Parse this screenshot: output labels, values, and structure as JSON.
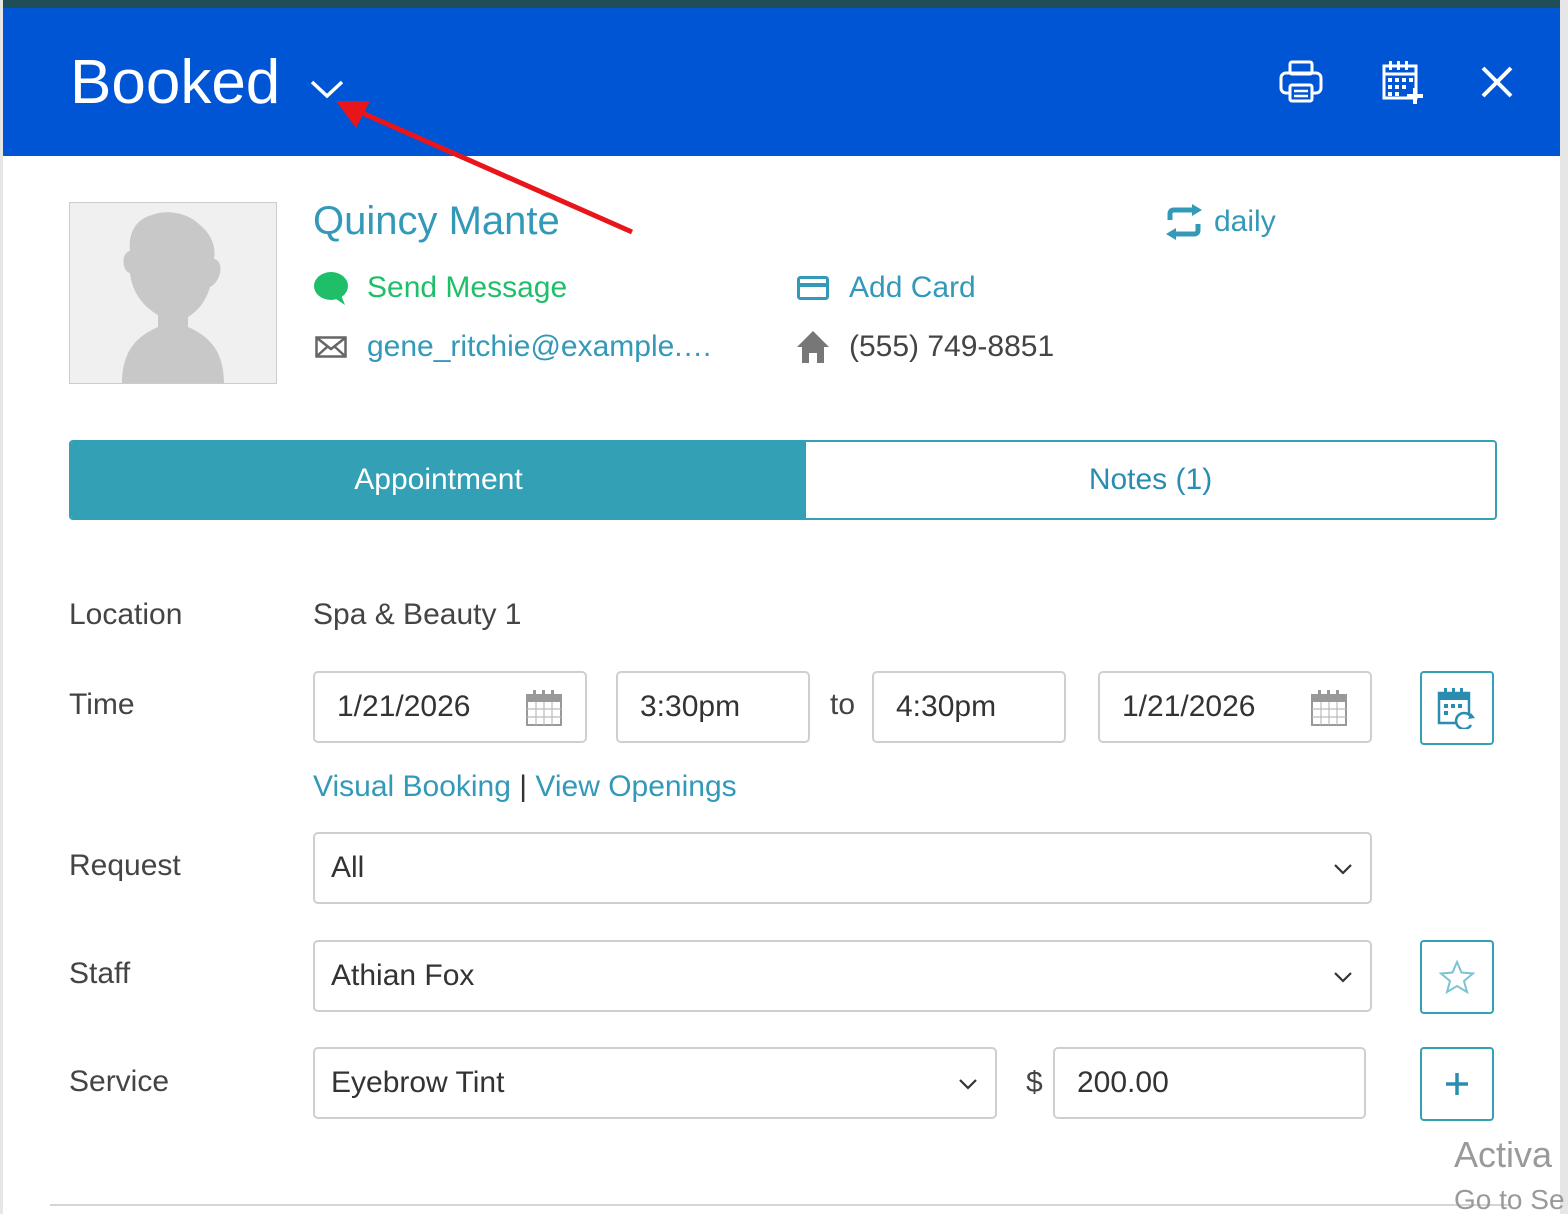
{
  "header": {
    "status": "Booked",
    "bg_color": "#0055d4",
    "icons": [
      "printer-icon",
      "calendar-add-icon",
      "close-icon"
    ]
  },
  "client": {
    "name": "Quincy Mante",
    "recurrence": "daily",
    "send_message": "Send Message",
    "add_card": "Add Card",
    "email": "gene_ritchie@example.…",
    "phone": "(555) 749-8851"
  },
  "tabs": {
    "appointment": "Appointment",
    "notes": "Notes (1)"
  },
  "form": {
    "location_label": "Location",
    "location_value": "Spa & Beauty 1",
    "time_label": "Time",
    "start_date": "1/21/2026",
    "start_time": "3:30pm",
    "to_label": "to",
    "end_time": "4:30pm",
    "end_date": "1/21/2026",
    "visual_booking": "Visual Booking",
    "separator": "|",
    "view_openings": "View Openings",
    "request_label": "Request",
    "request_value": "All",
    "staff_label": "Staff",
    "staff_value": "Athian Fox",
    "service_label": "Service",
    "service_value": "Eyebrow Tint",
    "currency": "$",
    "price": "200.00"
  },
  "watermark": {
    "line1": "Activa",
    "line2": "Go to Se"
  },
  "colors": {
    "accent": "#33a0b5",
    "link": "#3399b8",
    "message_green": "#1fbf6a",
    "annotation_arrow": "#e8161b"
  }
}
